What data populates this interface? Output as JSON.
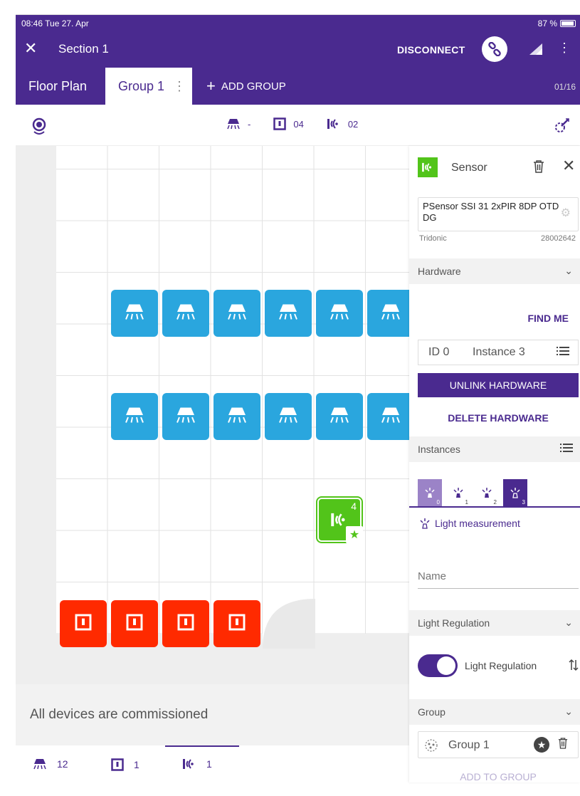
{
  "status_bar": {
    "time": "08:46  Tue 27. Apr",
    "battery": "87 %"
  },
  "toolbar": {
    "close": "✕",
    "title": "Section 1",
    "disconnect": "DISCONNECT"
  },
  "tabs": {
    "floor_plan": "Floor Plan",
    "group": "Group 1",
    "add_group": "ADD GROUP",
    "page_count": "01/16"
  },
  "summary": {
    "luminaires": "-",
    "switches": "04",
    "sensors": "02"
  },
  "floor": {
    "sensor_tile_number": "4",
    "commission_message": "All devices are commissioned"
  },
  "bottom_tabs": {
    "luminaires": "12",
    "switches": "1",
    "sensors": "1"
  },
  "panel": {
    "title": "Sensor",
    "device_name": "PSensor SSI 31 2xPIR 8DP OTD DG",
    "manufacturer": "Tridonic",
    "article_number": "28002642",
    "hardware_section": "Hardware",
    "find_me": "FIND ME",
    "id_label": "ID 0",
    "instance_label": "Instance 3",
    "unlink": "UNLINK HARDWARE",
    "delete": "DELETE HARDWARE",
    "instances_section": "Instances",
    "instance_tabs": [
      "0",
      "1",
      "2",
      "3"
    ],
    "light_measurement": "Light measurement",
    "name_placeholder": "Name",
    "light_regulation_section": "Light Regulation",
    "light_regulation_toggle": "Light Regulation",
    "group_section": "Group",
    "group_name": "Group 1",
    "add_to_group": "ADD TO GROUP"
  },
  "colors": {
    "primary": "#4a2a8f",
    "light_tile": "#2aa6de",
    "switch_tile": "#ff2a00",
    "sensor_tile": "#52c41a"
  }
}
